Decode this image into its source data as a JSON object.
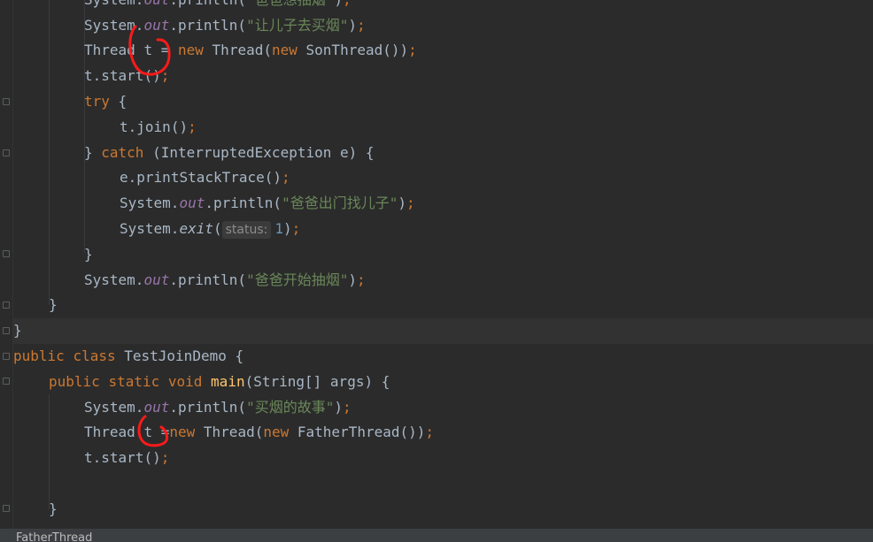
{
  "strings": {
    "s0": "\"爸爸想抽烟\"",
    "s1": "\"让儿子去买烟\"",
    "s2": "\"爸爸出门找儿子\"",
    "s3": "\"爸爸开始抽烟\"",
    "s4": "\"买烟的故事\""
  },
  "tokens": {
    "system": "System",
    "out": "out",
    "println": "println",
    "thread": "Thread",
    "t": "t",
    "eq": "=",
    "new": "new",
    "son_thread": "SonThread",
    "father_thread": "FatherThread",
    "start": "start",
    "try": "try",
    "join": "join",
    "catch": "catch",
    "interrupted_exception": "InterruptedException",
    "e": "e",
    "print_stack_trace": "printStackTrace",
    "exit": "exit",
    "public": "public",
    "class": "class",
    "class_name": "TestJoinDemo",
    "static": "static",
    "void": "void",
    "main": "main",
    "string_arr": "String[]",
    "args": "args",
    "one": "1"
  },
  "param_hint": "status:",
  "status_bar": {
    "breadcrumb": "FatherThread"
  },
  "colors": {
    "background": "#2b2b2b",
    "keyword": "#cc7832",
    "string": "#6a8759",
    "field": "#9876aa",
    "method_decl": "#ffc66d",
    "number": "#6897bb",
    "annotation_red": "#ff1a1a"
  }
}
